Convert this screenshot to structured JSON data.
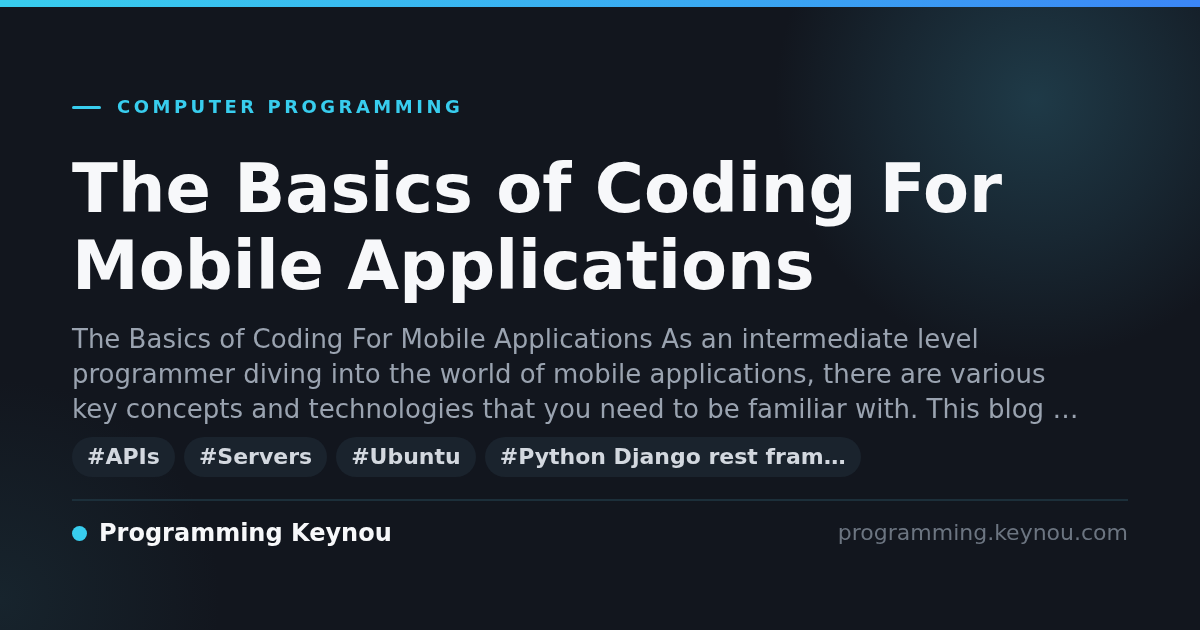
{
  "category": "COMPUTER PROGRAMMING",
  "title": "The Basics of Coding For Mobile Applications",
  "excerpt": "The Basics of Coding For Mobile Applications As an intermediate level programmer diving into the world of mobile applications, there are various key concepts and technologies that you need to be familiar with. This blog …",
  "tags": [
    "#APIs",
    "#Servers",
    "#Ubuntu",
    "#Python Django rest fram…"
  ],
  "footer": {
    "site_name": "Programming Keynou",
    "url": "programming.keynou.com"
  }
}
